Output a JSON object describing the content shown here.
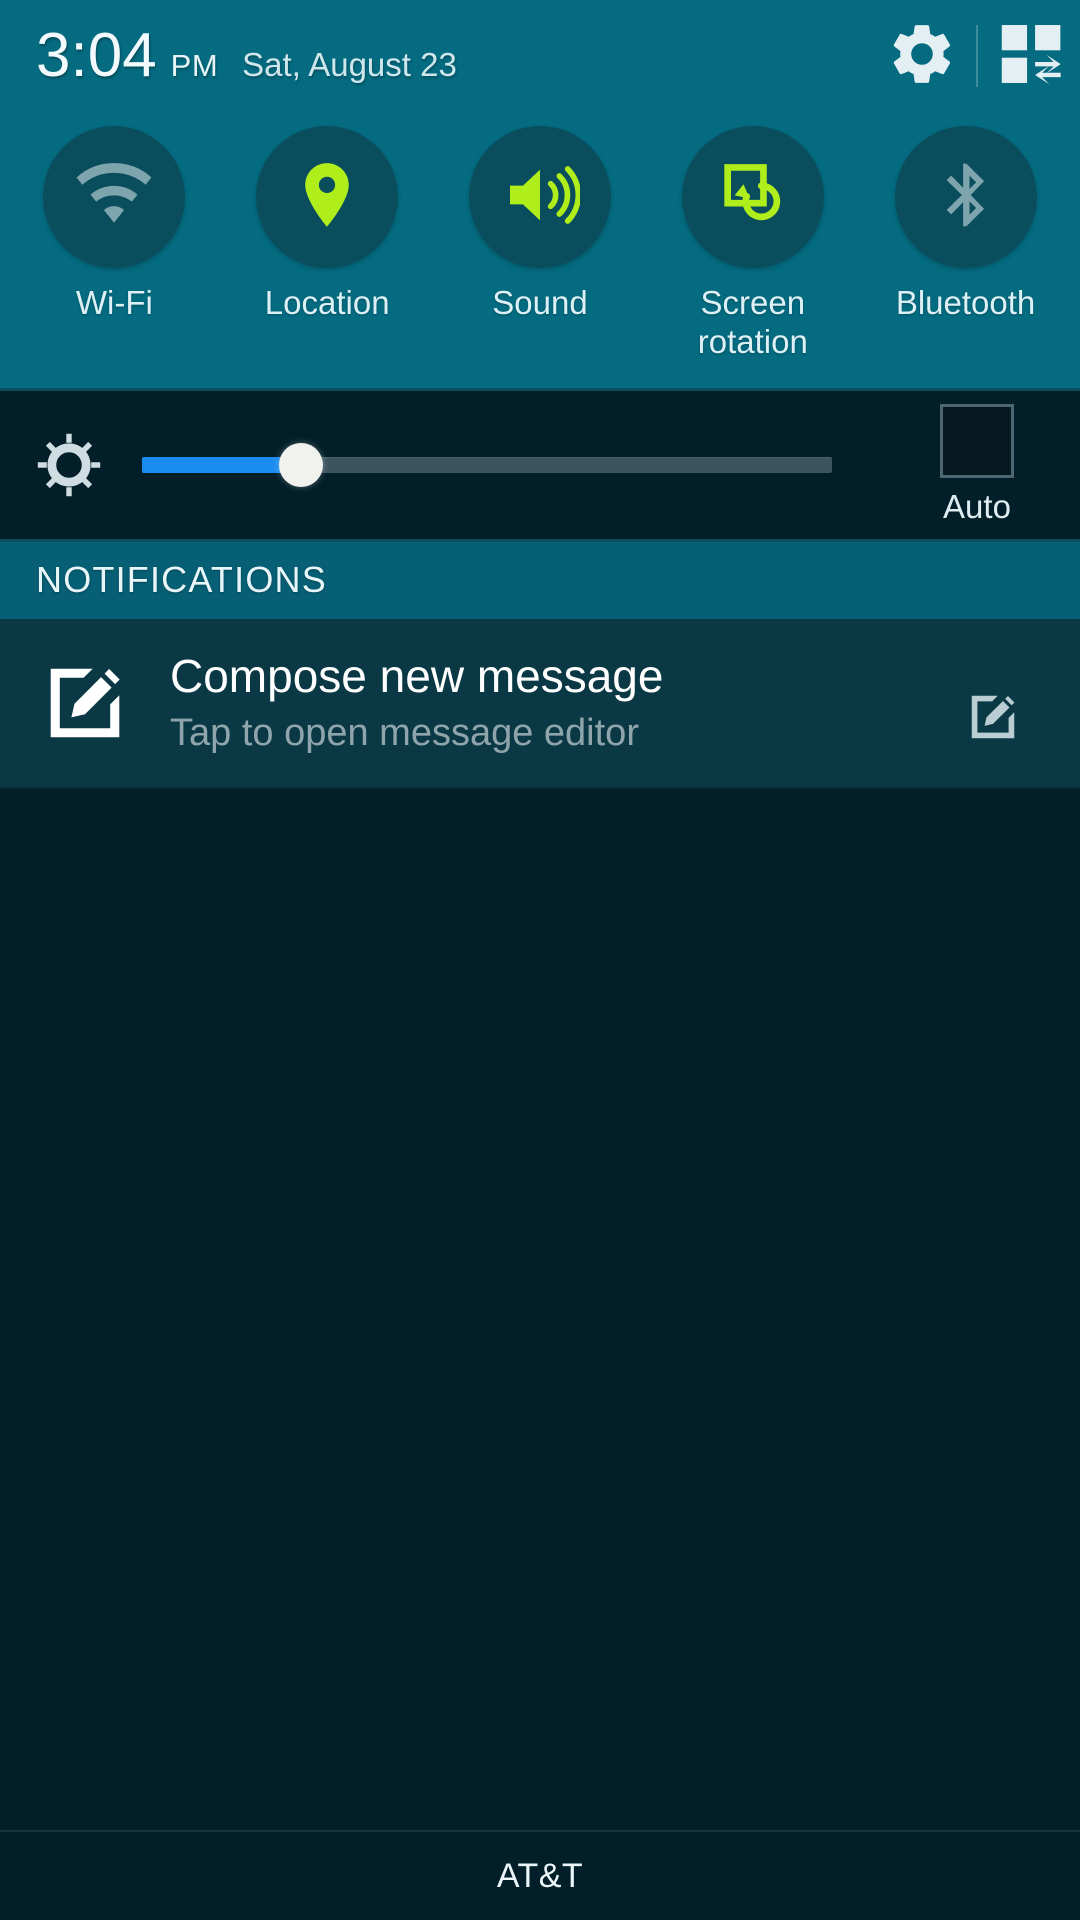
{
  "statusbar": {
    "time": "3:04",
    "ampm": "PM",
    "date": "Sat, August 23",
    "settings_icon": "gear-icon",
    "edit_toggles_icon": "quick-settings-edit-icon"
  },
  "quick_settings": {
    "toggles": [
      {
        "id": "wifi",
        "label": "Wi-Fi",
        "icon": "wifi-icon",
        "state": "off"
      },
      {
        "id": "location",
        "label": "Location",
        "icon": "location-pin-icon",
        "state": "on"
      },
      {
        "id": "sound",
        "label": "Sound",
        "icon": "sound-volume-icon",
        "state": "on"
      },
      {
        "id": "rotation",
        "label": "Screen rotation",
        "icon": "screen-rotation-icon",
        "state": "on"
      },
      {
        "id": "bluetooth",
        "label": "Bluetooth",
        "icon": "bluetooth-icon",
        "state": "off"
      }
    ],
    "colors": {
      "panel_background": "#046b80",
      "circle_background": "#0a4e5e",
      "icon_on": "#b0ee1b",
      "icon_off": "#7ea5ae"
    }
  },
  "brightness": {
    "icon": "brightness-sun-icon",
    "value_percent": 23,
    "auto_label": "Auto",
    "auto_checked": false,
    "fill_color": "#1a8cf0",
    "track_color": "#3c5360"
  },
  "notifications": {
    "section_label": "NOTIFICATIONS",
    "items": [
      {
        "icon": "compose-message-icon",
        "title": "Compose new message",
        "subtitle": "Tap to open message editor",
        "action_icon": "compose-message-action-icon"
      }
    ]
  },
  "carrier": {
    "name": "AT&T"
  }
}
